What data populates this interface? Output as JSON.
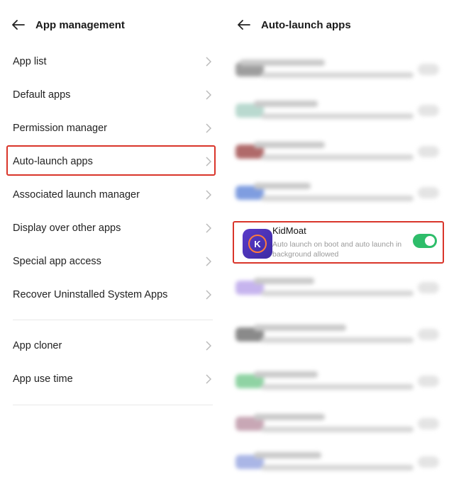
{
  "left": {
    "title": "App management",
    "items": [
      {
        "label": "App list"
      },
      {
        "label": "Default apps"
      },
      {
        "label": "Permission manager"
      },
      {
        "label": "Auto-launch apps"
      },
      {
        "label": "Associated launch manager"
      },
      {
        "label": "Display over other apps"
      },
      {
        "label": "Special app access"
      },
      {
        "label": "Recover Uninstalled System Apps"
      },
      {
        "label": "App cloner"
      },
      {
        "label": "App use time"
      }
    ]
  },
  "right": {
    "title": "Auto-launch apps",
    "app": {
      "name": "KidMoat",
      "description": "Auto launch on boot and auto launch in background allowed",
      "toggle_on": true
    }
  },
  "colors": {
    "highlight": "#d9352a",
    "toggle_on": "#2ebd6a",
    "app_icon": "#4b33b8"
  }
}
